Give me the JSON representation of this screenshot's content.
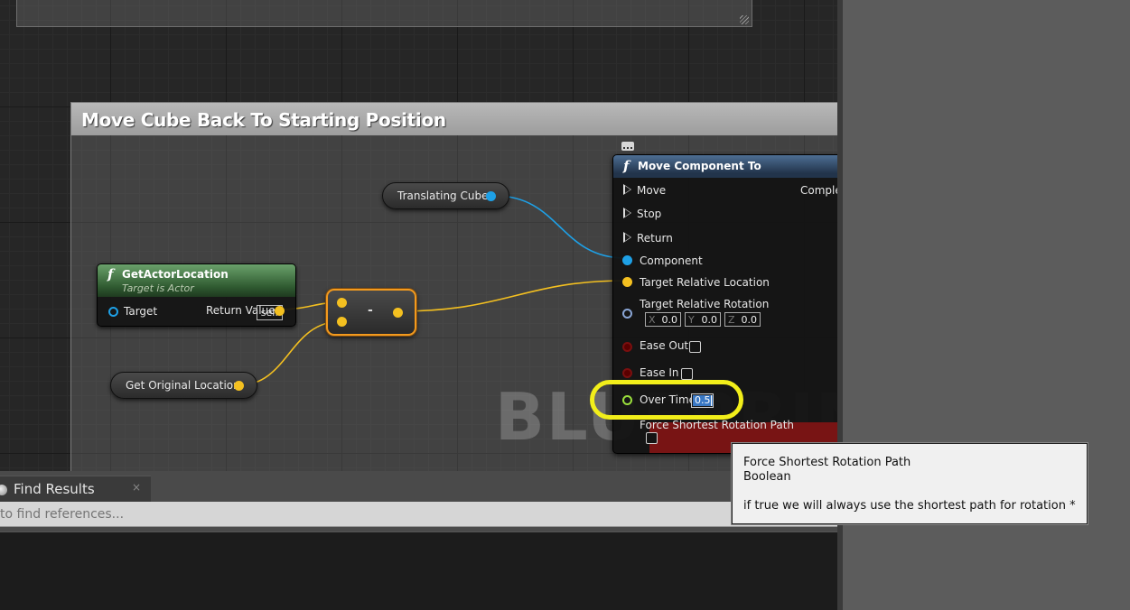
{
  "comment_title": "Move Cube Back To Starting Position",
  "watermark": "BLUEPRINT",
  "nodes": {
    "translating_cube": "Translating Cube",
    "get_original_location": "Get Original Location",
    "get_actor_location": {
      "title": "GetActorLocation",
      "subtitle": "Target is Actor",
      "target_label": "Target",
      "target_value": "self",
      "return_label": "Return Value"
    },
    "subtract": {
      "operator": "-"
    },
    "move_component_to": {
      "title": "Move Component To",
      "completed_label": "Comple",
      "exec_inputs": [
        "Move",
        "Stop",
        "Return"
      ],
      "component_label": "Component",
      "target_relative_location_label": "Target Relative Location",
      "target_relative_rotation_label": "Target Relative Rotation",
      "rotation": {
        "x_label": "X",
        "x": "0.0",
        "y_label": "Y",
        "y": "0.0",
        "z_label": "Z",
        "z": "0.0"
      },
      "ease_out_label": "Ease Out",
      "ease_in_label": "Ease In",
      "over_time_label": "Over Time",
      "over_time_value": "0.5",
      "force_shortest_label": "Force Shortest Rotation Path"
    }
  },
  "tooltip": {
    "title": "Force Shortest Rotation Path",
    "type": "Boolean",
    "description": "if true we will always use the shortest path for rotation *"
  },
  "find_results": {
    "tab_label": "Find Results",
    "close_label": "×",
    "search_placeholder": "to find references..."
  },
  "colors": {
    "exec_wire": "#1ea0e6",
    "vector_wire": "#f4c020",
    "highlight": "#f2ee1a",
    "node_header_green": "#2f5a30",
    "node_header_blue": "#22344b"
  }
}
